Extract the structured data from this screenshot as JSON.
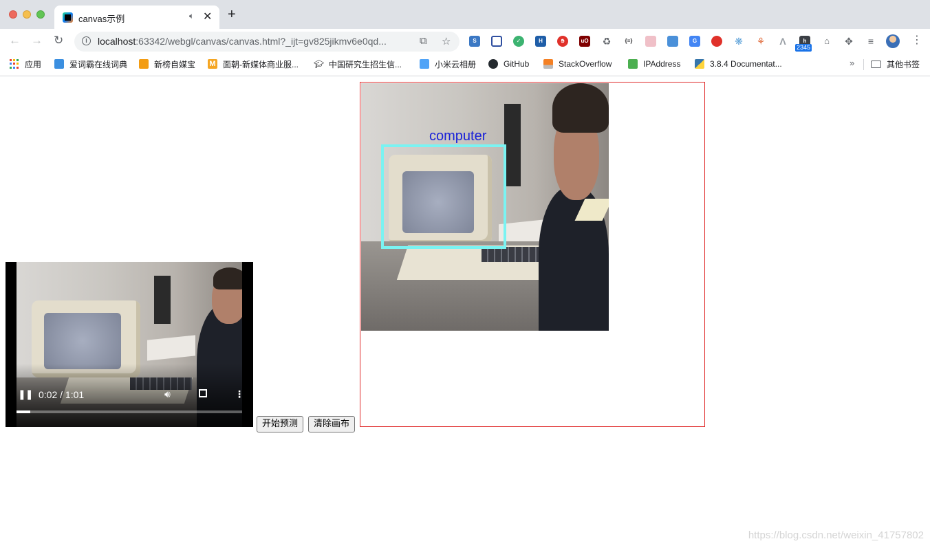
{
  "browser": {
    "tab_title": "canvas示例",
    "tab_audio_icon": "speaker-icon",
    "url_host": "localhost",
    "url_rest": ":63342/webgl/canvas/canvas.html?_ijt=gv825jikmv6e0qd...",
    "extension_badge": "2345",
    "bookmarks": [
      {
        "label": "应用",
        "icon": "apps-grid-icon"
      },
      {
        "label": "爱词霸在线词典",
        "icon": "iciba-icon"
      },
      {
        "label": "新榜自媒宝",
        "icon": "newrank-icon"
      },
      {
        "label": "面朝-新媒体商业服...",
        "icon": "mianchao-icon"
      },
      {
        "label": "中国研究生招生信...",
        "icon": "graduation-cap-icon"
      },
      {
        "label": "小米云相册",
        "icon": "cloud-icon"
      },
      {
        "label": "GitHub",
        "icon": "github-icon"
      },
      {
        "label": "StackOverflow",
        "icon": "stackoverflow-icon"
      },
      {
        "label": "IPAddress",
        "icon": "ipaddress-icon"
      },
      {
        "label": "3.8.4 Documentat...",
        "icon": "python-icon"
      }
    ],
    "bookmarks_overflow": "»",
    "other_bookmarks": "其他书签"
  },
  "video": {
    "current_time": "0:02",
    "separator": " / ",
    "duration": "1:01",
    "progress_fraction": 0.06,
    "state": "playing"
  },
  "buttons": {
    "start": "开始预测",
    "clear": "清除画布"
  },
  "canvas": {
    "border_color": "#e02a2a",
    "detection": {
      "label": "computer",
      "label_color": "#1a22d8",
      "box_color": "#7af3f2"
    }
  },
  "watermark": "https://blog.csdn.net/weixin_41757802"
}
